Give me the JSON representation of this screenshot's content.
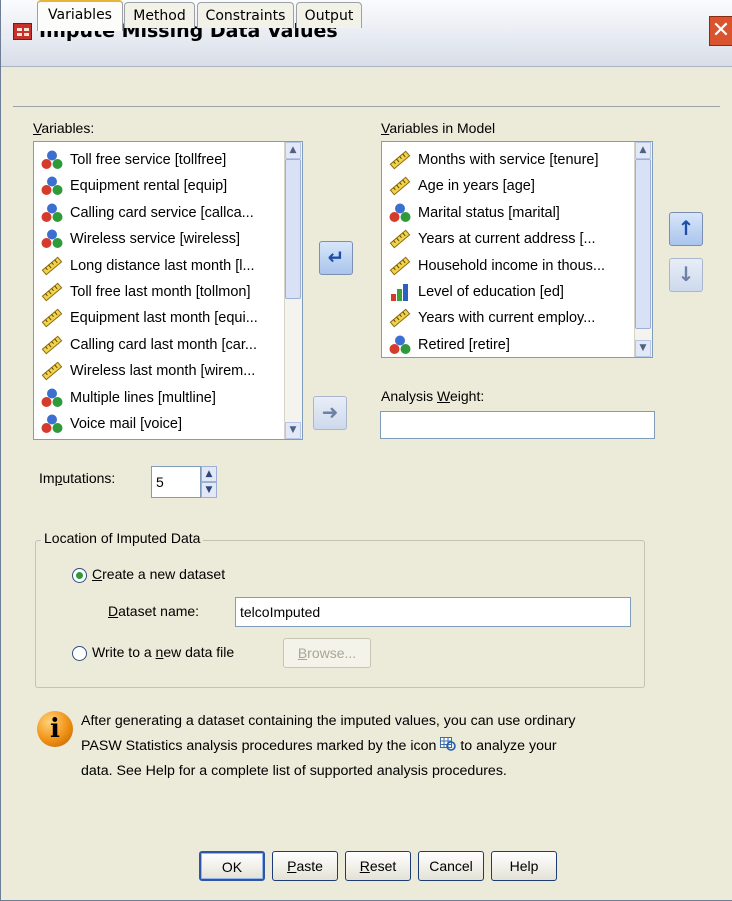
{
  "window": {
    "title": "Impute Missing Data Values",
    "close_label": "✕"
  },
  "tabs": [
    {
      "label": "Variables"
    },
    {
      "label": "Method"
    },
    {
      "label": "Constraints"
    },
    {
      "label": "Output"
    }
  ],
  "variables_list": {
    "label_prefix": "",
    "label_u": "V",
    "label_rest": "ariables:",
    "items": [
      {
        "label": "Toll free service [tollfree]",
        "type": "nominal-icon"
      },
      {
        "label": "Equipment rental [equip]",
        "type": "nominal-icon"
      },
      {
        "label": "Calling card service [callca...",
        "type": "nominal-icon"
      },
      {
        "label": "Wireless service [wireless]",
        "type": "nominal-icon"
      },
      {
        "label": "Long distance last month [l...",
        "type": "scale-icon"
      },
      {
        "label": "Toll free last month [tollmon]",
        "type": "scale-icon"
      },
      {
        "label": "Equipment last month [equi...",
        "type": "scale-icon"
      },
      {
        "label": "Calling card last month [car...",
        "type": "scale-icon"
      },
      {
        "label": "Wireless last month [wirem...",
        "type": "scale-icon"
      },
      {
        "label": "Multiple lines [multline]",
        "type": "nominal-icon"
      },
      {
        "label": "Voice mail [voice]",
        "type": "nominal-icon"
      }
    ]
  },
  "model_list": {
    "label_u": "V",
    "label_rest": "ariables in Model",
    "items": [
      {
        "label": "Months with service [tenure]",
        "type": "scale-icon"
      },
      {
        "label": "Age in years [age]",
        "type": "scale-icon"
      },
      {
        "label": "Marital status [marital]",
        "type": "nominal-icon"
      },
      {
        "label": "Years at current address [...",
        "type": "scale-icon"
      },
      {
        "label": "Household income in thous...",
        "type": "scale-icon"
      },
      {
        "label": "Level of education [ed]",
        "type": "ordinal-icon"
      },
      {
        "label": "Years with current employ...",
        "type": "scale-icon"
      },
      {
        "label": "Retired [retire]",
        "type": "nominal-icon"
      }
    ]
  },
  "analysis_weight": {
    "label_pre": "Analysis ",
    "label_u": "W",
    "label_rest": "eight:",
    "value": ""
  },
  "imputations": {
    "label_pre": "Im",
    "label_u": "p",
    "label_rest": "utations:",
    "value": "5"
  },
  "location": {
    "legend": "Location of Imputed Data",
    "create_new": {
      "label_pre": "",
      "label_u": "C",
      "label_rest": "reate a new dataset",
      "selected": true
    },
    "dataset_name": {
      "label_pre": "",
      "label_u": "D",
      "label_rest": "ataset name:",
      "value": "telcoImputed"
    },
    "write_file": {
      "label_pre": "Write to a ",
      "label_u": "n",
      "label_rest": "ew data file",
      "selected": false
    },
    "browse": {
      "label_u": "B",
      "label_rest": "rowse..."
    }
  },
  "info": {
    "line1": "After generating a dataset containing the imputed values, you can use ordinary",
    "line2_a": "PASW Statistics analysis procedures marked by the icon",
    "line2_b": "to analyze your",
    "line3": "data. See Help for a complete list of supported analysis procedures."
  },
  "buttons": {
    "ok": "OK",
    "paste_u": "P",
    "paste_rest": "aste",
    "reset_u": "R",
    "reset_rest": "eset",
    "cancel": "Cancel",
    "help": "Help"
  },
  "colors": {
    "accent": "#2f55a6",
    "window_bg": "#ecead8",
    "tab_highlight": "#e8b53a"
  }
}
